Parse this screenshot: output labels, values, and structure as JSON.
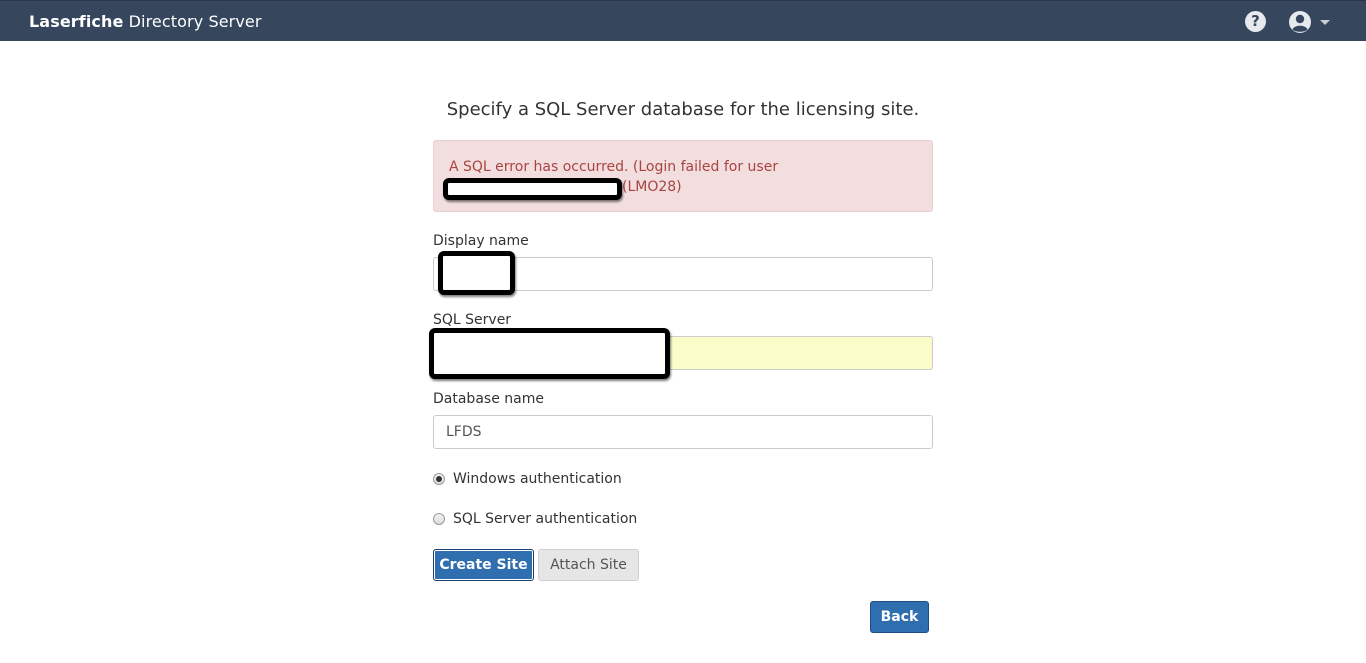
{
  "header": {
    "brand_bold": "Laserfiche",
    "brand_regular": " Directory Server",
    "help_glyph": "?",
    "colors": {
      "bar": "#36465d"
    }
  },
  "page": {
    "title": "Specify a SQL Server database for the licensing site."
  },
  "alert": {
    "line1": "A SQL error has occurred. (Login failed for user",
    "line2_suffix": "(LMO28)"
  },
  "form": {
    "display_name": {
      "label": "Display name",
      "value": ""
    },
    "sql_server": {
      "label": "SQL Server",
      "value": ""
    },
    "database_name": {
      "label": "Database name",
      "value": "LFDS"
    },
    "auth_options": [
      {
        "label": "Windows authentication",
        "checked": true
      },
      {
        "label": "SQL Server authentication",
        "checked": false
      }
    ]
  },
  "buttons": {
    "create_site": "Create Site",
    "attach_site": "Attach Site",
    "back": "Back"
  }
}
